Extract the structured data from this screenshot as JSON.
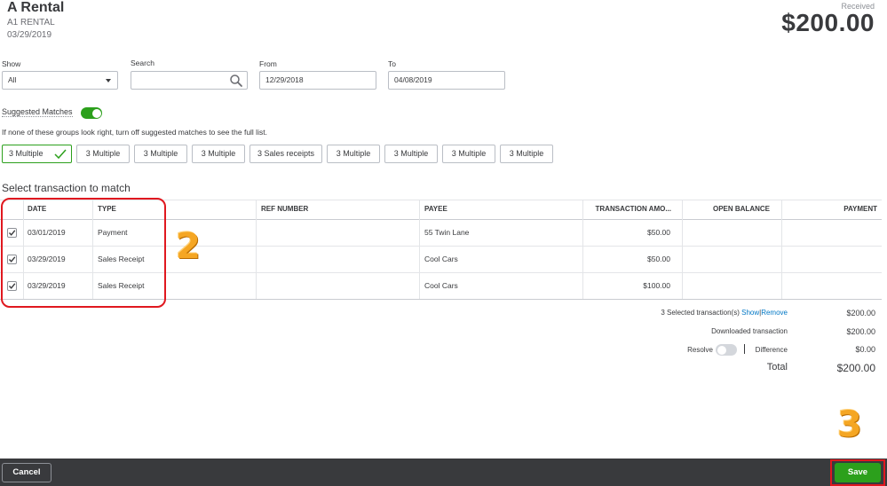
{
  "header": {
    "title": "A Rental",
    "account": "A1 RENTAL",
    "date": "03/29/2019",
    "received_label": "Received",
    "amount": "$200.00"
  },
  "filters": {
    "show_label": "Show",
    "show_value": "All",
    "search_label": "Search",
    "search_value": "",
    "from_label": "From",
    "from_value": "12/29/2018",
    "to_label": "To",
    "to_value": "04/08/2019"
  },
  "suggested": {
    "label": "Suggested Matches",
    "toggle_on": true,
    "hint": "If none of these groups look right, turn off suggested matches to see the full list.",
    "chips": [
      "3 Multiple",
      "3 Multiple",
      "3 Multiple",
      "3 Multiple",
      "3 Sales receipts",
      "3 Multiple",
      "3 Multiple",
      "3 Multiple",
      "3 Multiple"
    ]
  },
  "table": {
    "section_title": "Select transaction to match",
    "columns": [
      "DATE",
      "TYPE",
      "REF NUMBER",
      "PAYEE",
      "TRANSACTION AMO...",
      "OPEN BALANCE",
      "PAYMENT"
    ],
    "rows": [
      {
        "checked": true,
        "date": "03/01/2019",
        "type": "Payment",
        "ref": "",
        "payee": "55 Twin Lane",
        "amount": "$50.00",
        "open_balance": "",
        "payment": ""
      },
      {
        "checked": true,
        "date": "03/29/2019",
        "type": "Sales Receipt",
        "ref": "",
        "payee": "Cool Cars",
        "amount": "$50.00",
        "open_balance": "",
        "payment": ""
      },
      {
        "checked": true,
        "date": "03/29/2019",
        "type": "Sales Receipt",
        "ref": "",
        "payee": "Cool Cars",
        "amount": "$100.00",
        "open_balance": "",
        "payment": ""
      }
    ]
  },
  "summary": {
    "selected_label": "3 Selected transaction(s)",
    "show_link": "Show",
    "separator": "|",
    "remove_link": "Remove",
    "selected_value": "$200.00",
    "downloaded_label": "Downloaded transaction",
    "downloaded_value": "$200.00",
    "resolve_label": "Resolve",
    "difference_label": "Difference",
    "difference_value": "$0.00",
    "total_label": "Total",
    "total_value": "$200.00"
  },
  "footer": {
    "cancel_label": "Cancel",
    "save_label": "Save"
  },
  "annotations": {
    "marker_2": "2",
    "marker_3": "3",
    "highlight_color": "#e0181f",
    "marker_color": "#f5a623"
  },
  "colors": {
    "accent_green": "#2ca01c",
    "footer_bg": "#393a3d",
    "link_blue": "#0077c5"
  }
}
